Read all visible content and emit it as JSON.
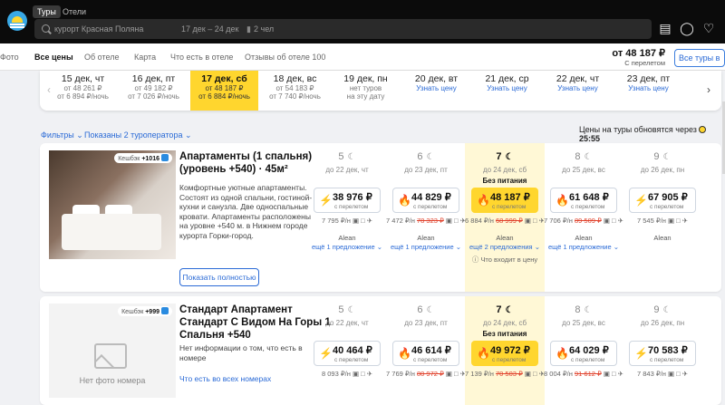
{
  "header": {
    "tabs": [
      "Туры",
      "Отели"
    ],
    "search": {
      "query": "курорт Красная Поляна",
      "dates": "17 дек – 24 дек",
      "guests": "2 чел"
    }
  },
  "subnav": {
    "items": [
      "Фото",
      "Все цены",
      "Об отеле",
      "Карта",
      "Что есть в отеле",
      "Отзывы об отеле 100"
    ],
    "price": "от 48 187 ₽",
    "price_note": "С перелетом",
    "all_tours": "Все туры в"
  },
  "dates": [
    {
      "d": "15 дек, чт",
      "p": "от 48 261 ₽",
      "pn": "от 6 894 ₽/ночь"
    },
    {
      "d": "16 дек, пт",
      "p": "от 49 182 ₽",
      "pn": "от 7 026 ₽/ночь"
    },
    {
      "d": "17 дек, сб",
      "p": "от 48 187 ₽",
      "pn": "от 6 884 ₽/ночь"
    },
    {
      "d": "18 дек, вс",
      "p": "от 54 183 ₽",
      "pn": "от 7 740 ₽/ночь"
    },
    {
      "d": "19 дек, пн",
      "p": "нет туров",
      "pn": "на эту дату"
    },
    {
      "d": "20 дек, вт",
      "link": "Узнать цену"
    },
    {
      "d": "21 дек, ср",
      "link": "Узнать цену"
    },
    {
      "d": "22 дек, чт",
      "link": "Узнать цену"
    },
    {
      "d": "23 дек, пт",
      "link": "Узнать цену"
    }
  ],
  "filters": {
    "filters": "Фильтры ⌄",
    "shown": "Показаны 2 туроператора ⌄",
    "update": "Цены на туры обновятся через",
    "timer": "25:55"
  },
  "rooms": [
    {
      "title": "Апартаменты (1 спальня) (уровень +540) · 45м²",
      "desc": "Комфортные уютные апартаменты. Состоят из одной спальни, гостиной-кухни и санузла. Две односпальные кровати. Апартаменты расположены на уровне +540 м. в Нижнем городе курорта Горки-город.",
      "cashback": "Кешбэк",
      "cashback_val": "+1016",
      "show_full": "Показать полностью",
      "tours": [
        {
          "nights": "5",
          "until": "до 22 дек, чт",
          "meal": "",
          "price": "38 976 ₽",
          "label": "с перелетом",
          "icon": "bolt",
          "per": "7 795 ₽/н",
          "old": "",
          "op": "Alean",
          "more": "ещё 1 предложение ⌄"
        },
        {
          "nights": "6",
          "until": "до 23 дек, пт",
          "meal": "",
          "price": "44 829 ₽",
          "label": "с перелетом",
          "icon": "fire",
          "per": "7 472 ₽/н",
          "old": "78 323 ₽",
          "op": "Alean",
          "more": "ещё 1 предложение ⌄"
        },
        {
          "nights": "7",
          "until": "до 24 дек, сб",
          "meal": "Без питания",
          "price": "48 187 ₽",
          "label": "с перелетом",
          "icon": "fire",
          "per": "6 884 ₽/н",
          "old": "68 999 ₽",
          "op": "Alean",
          "more": "ещё 2 предложения ⌄",
          "incl": "Что входит в цену"
        },
        {
          "nights": "8",
          "until": "до 25 дек, вс",
          "meal": "",
          "price": "61 648 ₽",
          "label": "с перелетом",
          "icon": "fire",
          "per": "7 706 ₽/н",
          "old": "89 509 ₽",
          "op": "Alean",
          "more": "ещё 1 предложение ⌄"
        },
        {
          "nights": "9",
          "until": "до 26 дек, пн",
          "meal": "",
          "price": "67 905 ₽",
          "label": "с перелетом",
          "icon": "bolt",
          "per": "7 545 ₽/н",
          "old": "",
          "op": "Alean",
          "more": ""
        }
      ]
    },
    {
      "title": "Стандарт Апартамент Стандарт С Видом На Горы 1 Спальня +540",
      "desc": "Нет информации о том, что есть в номере",
      "link": "Что есть во всех номерах",
      "cashback": "Кешбэк",
      "cashback_val": "+999",
      "nophoto": "Нет фото номера",
      "tours": [
        {
          "nights": "5",
          "until": "до 22 дек, чт",
          "meal": "",
          "price": "40 464 ₽",
          "label": "с перелетом",
          "icon": "bolt",
          "per": "8 093 ₽/н",
          "old": ""
        },
        {
          "nights": "6",
          "until": "до 23 дек, пт",
          "meal": "",
          "price": "46 614 ₽",
          "label": "с перелетом",
          "icon": "fire",
          "per": "7 769 ₽/н",
          "old": "80 972 ₽"
        },
        {
          "nights": "7",
          "until": "до 24 дек, сб",
          "meal": "Без питания",
          "price": "49 972 ₽",
          "label": "с перелетом",
          "icon": "fire",
          "per": "7 139 ₽/н",
          "old": "70 503 ₽"
        },
        {
          "nights": "8",
          "until": "до 25 дек, вс",
          "meal": "",
          "price": "64 029 ₽",
          "label": "с перелетом",
          "icon": "fire",
          "per": "8 004 ₽/н",
          "old": "91 612 ₽"
        },
        {
          "nights": "9",
          "until": "до 26 дек, пн",
          "meal": "",
          "price": "70 583 ₽",
          "label": "с перелетом",
          "icon": "bolt",
          "per": "7 843 ₽/н",
          "old": ""
        }
      ]
    }
  ]
}
